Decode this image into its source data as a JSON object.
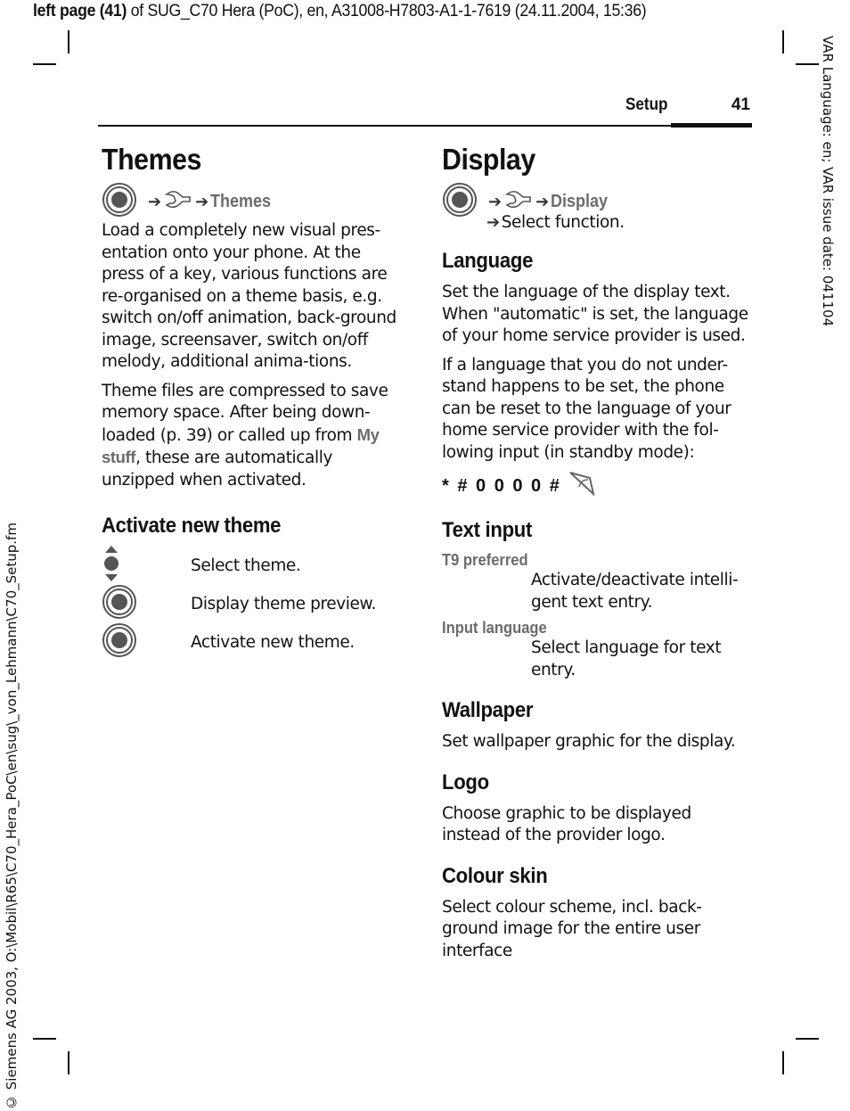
{
  "header_meta": {
    "bold_part": "left page (41)",
    "rest": " of SUG_C70 Hera (PoC), en, A31008-H7803-A1-1-7619 (24.11.2004, 15:36)"
  },
  "side_right": "VAR Language: en; VAR issue date: 041104",
  "side_left": "© Siemens AG 2003, O:\\Mobil\\R65\\C70_Hera_PoC\\en\\sug\\_von_Lehmann\\C70_Setup.fm",
  "running_head": {
    "section": "Setup",
    "page": "41"
  },
  "icons": {
    "center_key": "joystick-press-icon",
    "setup_menu": "wrench-icon",
    "arrow": "➔",
    "updown": "navigation-updown-icon",
    "send_key": "send-key-icon"
  },
  "left": {
    "title": "Themes",
    "path_label": "Themes",
    "para1": "Load a completely new visual pres-entation onto your phone. At the press of a key, various functions are re-organised on a theme basis, e.g. switch on/off animation, back-ground image, screensaver, switch on/off melody, additional anima-tions.",
    "para2_a": "Theme files are compressed to save memory space. After being down-loaded (p. 39) or called up from ",
    "para2_hl": "My stuff",
    "para2_b": ", these are automatically unzipped when activated.",
    "sub_title": "Activate new theme",
    "steps": [
      {
        "icon": "navigation-updown-icon",
        "text": "Select theme."
      },
      {
        "icon": "joystick-press-icon",
        "text": "Display theme preview."
      },
      {
        "icon": "joystick-press-icon",
        "text": "Activate new theme."
      }
    ]
  },
  "right": {
    "title": "Display",
    "path_label": "Display",
    "path_sub": "Select function.",
    "sections": {
      "language": {
        "title": "Language",
        "para1": "Set the language of the display text. When \"automatic\" is set, the language of your home service provider is used.",
        "para2": "If a language that you do not under-stand happens to be set, the phone can be reset to the language of your home service provider with the fol-lowing input (in standby mode):",
        "code": "* # 0 0 0 0 #"
      },
      "text_input": {
        "title": "Text input",
        "options": [
          {
            "name": "T9 preferred",
            "desc": "Activate/deactivate intelli-gent text entry."
          },
          {
            "name": "Input language",
            "desc": "Select language for text entry."
          }
        ]
      },
      "wallpaper": {
        "title": "Wallpaper",
        "text": "Set wallpaper graphic for the display."
      },
      "logo": {
        "title": "Logo",
        "text": "Choose graphic to be displayed instead of the provider logo."
      },
      "colour_skin": {
        "title": "Colour skin",
        "text": "Select colour scheme, incl. back-ground image for the entire user interface"
      }
    }
  },
  "colors": {
    "text": "#111111",
    "highlight": "#6b6b6b",
    "icon": "#555555"
  }
}
